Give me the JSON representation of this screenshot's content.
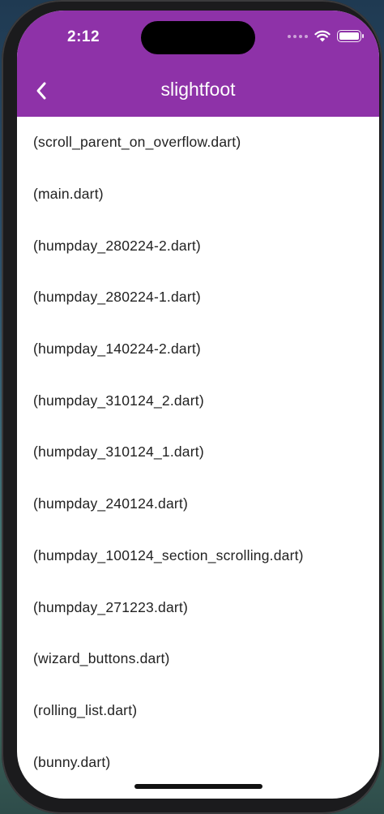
{
  "status_bar": {
    "time": "2:12",
    "icons": [
      "cellular-signal-icon",
      "wifi-icon",
      "battery-icon"
    ]
  },
  "app_bar": {
    "title": "slightfoot",
    "back_icon": "chevron-left-icon",
    "color": "#8e32a8"
  },
  "files": [
    {
      "label": "(scroll_parent_on_overflow.dart)"
    },
    {
      "label": "(main.dart)"
    },
    {
      "label": "(humpday_280224-2.dart)"
    },
    {
      "label": "(humpday_280224-1.dart)"
    },
    {
      "label": "(humpday_140224-2.dart)"
    },
    {
      "label": "(humpday_310124_2.dart)"
    },
    {
      "label": "(humpday_310124_1.dart)"
    },
    {
      "label": "(humpday_240124.dart)"
    },
    {
      "label": "(humpday_100124_section_scrolling.dart)"
    },
    {
      "label": "(humpday_271223.dart)"
    },
    {
      "label": "(wizard_buttons.dart)"
    },
    {
      "label": "(rolling_list.dart)"
    },
    {
      "label": "(bunny.dart)"
    }
  ]
}
